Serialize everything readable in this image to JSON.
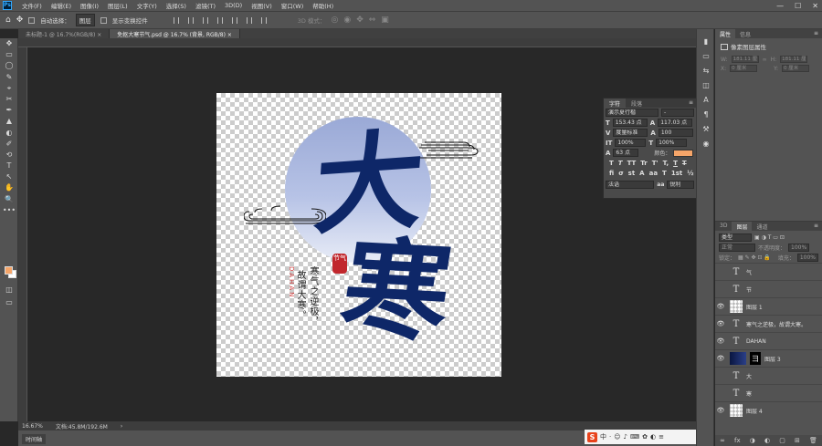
{
  "app": {
    "logo": "Ps"
  },
  "menubar": {
    "items": [
      "文件(F)",
      "编辑(E)",
      "图像(I)",
      "图层(L)",
      "文字(Y)",
      "选择(S)",
      "滤镜(T)",
      "3D(D)",
      "视图(V)",
      "窗口(W)",
      "帮助(H)"
    ],
    "window_controls": {
      "minimize": "—",
      "maximize": "☐",
      "close": "✕"
    }
  },
  "options": {
    "home_icon": "⌂",
    "move_icon": "✥",
    "auto_select_label": "自动选择：",
    "auto_select_value": "图层",
    "show_transform_label": "显示变换控件",
    "mode_label": "3D 模式："
  },
  "tabs": [
    {
      "label": "未标题-1 @ 16.7%(RGB/8) ×",
      "active": false
    },
    {
      "label": "免抠大寒节气.psd @ 16.7% (背景, RGB/8) ×",
      "active": true
    }
  ],
  "tools": [
    "✥",
    "▭",
    "◯",
    "✎",
    "⌖",
    "✂",
    "✒",
    "▲",
    "◐",
    "✐",
    "⟲",
    "T",
    "↖",
    "✋",
    "🔍",
    "•••"
  ],
  "colors": {
    "foreground": "#f5a569",
    "background": "#ffffff",
    "text_navy": "#0e2768",
    "seal_red": "#c1272d"
  },
  "artwork": {
    "char_da": "大",
    "char_han": "寒",
    "poem_line1": "寒气之逆极，",
    "poem_line2": "故谓大寒。",
    "english": "DAHAN",
    "seal_text": "节气"
  },
  "status": {
    "zoom": "16.67%",
    "doc": "文档:45.8M/192.6M",
    "arrow": "›"
  },
  "timeline": {
    "label": "时间轴"
  },
  "ime": {
    "logo": "S",
    "items": [
      "中",
      "·",
      "☺",
      "♪",
      "⌨",
      "✿",
      "◐",
      "≡"
    ]
  },
  "character_panel": {
    "tabs": [
      "字符",
      "段落"
    ],
    "font_family": "演示夏行楷",
    "font_style": "-",
    "font_size": "153.43 点",
    "leading": "117.03 点",
    "kerning": "度量标准",
    "tracking": "100",
    "vscale": "100%",
    "hscale": "100%",
    "baseline": "63 点",
    "color_label": "颜色：",
    "style_buttons": [
      "T",
      "T",
      "TT",
      "Tr",
      "T'",
      "T,",
      "T",
      "T"
    ],
    "ot_buttons": [
      "fi",
      "σ",
      "st",
      "A",
      "aa",
      "T",
      "1st",
      "½"
    ],
    "language": "法语",
    "antialias": "锐利"
  },
  "right_strip": [
    "▮",
    "▭",
    "⇆",
    "◫",
    "A",
    "¶",
    "⚒",
    "◉"
  ],
  "properties": {
    "tabs": [
      "属性",
      "信息"
    ],
    "title": "像素图层属性",
    "w_label": "W:",
    "w_value": "181.11 厘",
    "link": "∞",
    "h_label": "H:",
    "h_value": "181.11 厘",
    "x_label": "X:",
    "x_value": "0 厘米",
    "y_label": "Y:",
    "y_value": "0 厘米"
  },
  "layers_panel": {
    "tabs": [
      "3D",
      "图层",
      "通道"
    ],
    "filter_kind": "类型",
    "blend_mode": "正常",
    "opacity_label": "不透明度：",
    "opacity": "100%",
    "lock_label": "锁定：",
    "fill_label": "填充：",
    "fill": "100%",
    "layers": [
      {
        "name": "气",
        "type": "text",
        "visible": false
      },
      {
        "name": "节",
        "type": "text",
        "visible": false
      },
      {
        "name": "图层 1",
        "type": "pixel",
        "visible": true
      },
      {
        "name": "寒气之逆极，故谓大寒。",
        "type": "text",
        "visible": true
      },
      {
        "name": "DAHAN",
        "type": "text",
        "visible": true
      },
      {
        "name": "图层 3",
        "type": "masked",
        "visible": true
      },
      {
        "name": "大",
        "type": "text",
        "visible": false
      },
      {
        "name": "寒",
        "type": "text",
        "visible": false
      },
      {
        "name": "图层 4",
        "type": "pixel",
        "visible": true
      }
    ],
    "footer_icons": [
      "∞",
      "fx",
      "◑",
      "◐",
      "▢",
      "⊞",
      "🗑"
    ]
  }
}
